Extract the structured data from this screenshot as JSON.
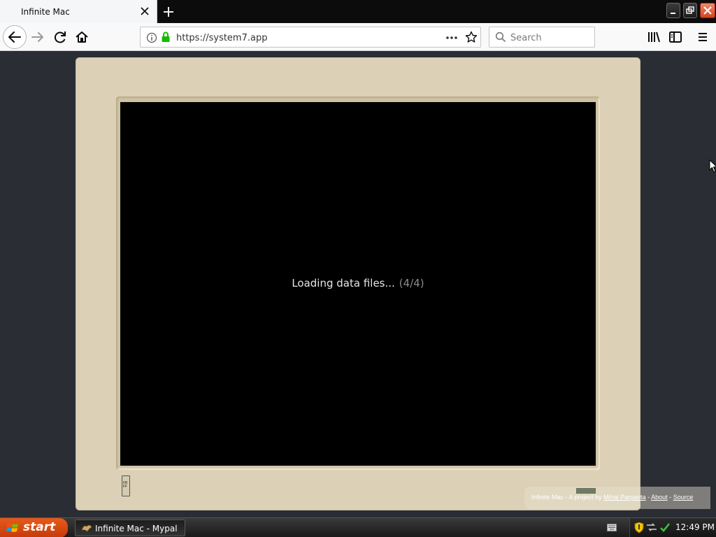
{
  "browser": {
    "tab_title": "Infinite Mac",
    "url": "https://system7.app",
    "search_placeholder": "Search"
  },
  "emulator": {
    "loading_text": "Loading data files...",
    "loading_count": "(4/4)",
    "floppy_label": "FB FF"
  },
  "credits": {
    "prefix": "Infinite Mac - A project by",
    "author": "Mihai Parparita",
    "sep1": "-",
    "about": "About",
    "sep2": "-",
    "source": "Source"
  },
  "taskbar": {
    "start_label": "start",
    "task_label": "Infinite Mac - Mypal",
    "clock": "12:49 PM"
  },
  "colors": {
    "monitor_beige": "#dcd1b7",
    "page_background": "#2a2d33",
    "start_orange": "#e85a1a",
    "lock_green": "#12bc00"
  }
}
